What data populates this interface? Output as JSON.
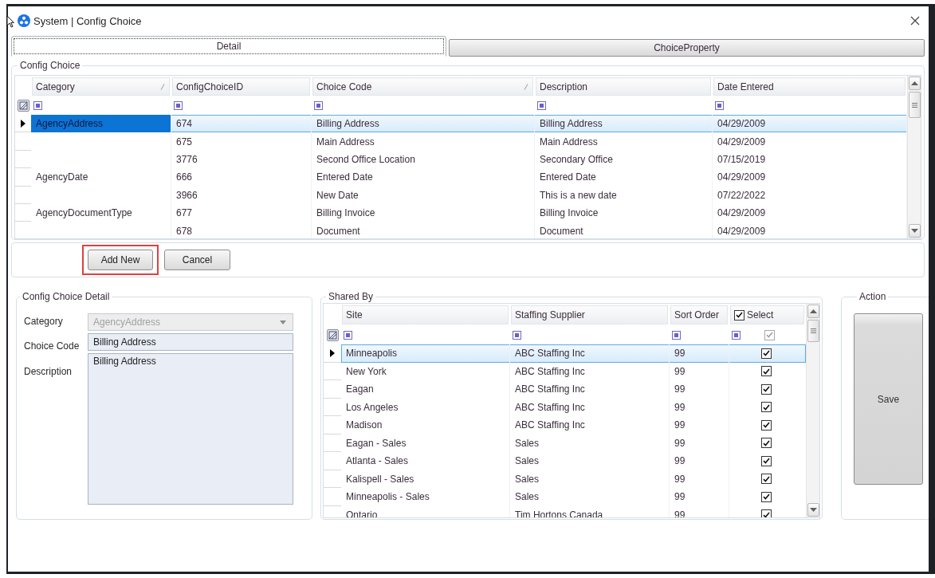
{
  "window": {
    "title": "System | Config Choice"
  },
  "tabs": [
    {
      "label": "Detail",
      "selected": true
    },
    {
      "label": "ChoiceProperty",
      "selected": false
    }
  ],
  "config_choice": {
    "title": "Config Choice",
    "columns": [
      {
        "label": "Category",
        "sorted": true
      },
      {
        "label": "ConfigChoiceID",
        "sorted": false
      },
      {
        "label": "Choice Code",
        "sorted": true
      },
      {
        "label": "Description",
        "sorted": false
      },
      {
        "label": "Date Entered",
        "sorted": false
      }
    ],
    "rows": [
      {
        "category": "AgencyAddress",
        "config_choice_id": "674",
        "choice_code": "Billing Address",
        "description": "Billing Address",
        "date_entered": "04/29/2009",
        "selected": true,
        "focused": true
      },
      {
        "config_choice_id": "675",
        "choice_code": "Main Address",
        "description": "Main Address",
        "date_entered": "04/29/2009",
        "selected": false,
        "focused": false
      },
      {
        "config_choice_id": "3776",
        "choice_code": "Second Office Location",
        "description": "Secondary Office",
        "date_entered": "07/15/2019",
        "selected": false,
        "focused": false
      },
      {
        "category": "AgencyDate",
        "config_choice_id": "666",
        "choice_code": "Entered Date",
        "description": "Entered Date",
        "date_entered": "04/29/2009",
        "selected": false,
        "focused": false
      },
      {
        "config_choice_id": "3966",
        "choice_code": "New Date",
        "description": "This is a new date",
        "date_entered": "07/22/2022",
        "selected": false,
        "focused": false
      },
      {
        "category": "AgencyDocumentType",
        "config_choice_id": "677",
        "choice_code": "Billing Invoice",
        "description": "Billing Invoice",
        "date_entered": "04/29/2009",
        "selected": false,
        "focused": false
      },
      {
        "config_choice_id": "678",
        "choice_code": "Document",
        "description": "Document",
        "date_entered": "04/29/2009",
        "selected": false,
        "focused": false
      }
    ],
    "buttons": [
      {
        "label": "Add New",
        "highlighted": true
      },
      {
        "label": "Cancel",
        "highlighted": false
      }
    ]
  },
  "detail": {
    "title": "Config Choice Detail",
    "category": {
      "label": "Category",
      "value": "AgencyAddress",
      "disabled": true
    },
    "choice_code": {
      "label": "Choice Code",
      "value": "Billing Address"
    },
    "description": {
      "label": "Description",
      "value": "Billing Address"
    }
  },
  "shared_by": {
    "title": "Shared By",
    "columns": [
      {
        "label": "Site",
        "kind": "text"
      },
      {
        "label": "Staffing Supplier",
        "kind": "text"
      },
      {
        "label": "Sort Order",
        "kind": "text"
      },
      {
        "label": "Select",
        "kind": "checkbox",
        "checked": true,
        "filter_checked": true
      }
    ],
    "rows": [
      {
        "cells": [
          "Minneapolis",
          "ABC Staffing Inc",
          "99"
        ],
        "checked": true,
        "selected": true
      },
      {
        "cells": [
          "New York",
          "ABC Staffing Inc",
          "99"
        ],
        "checked": true,
        "selected": false
      },
      {
        "cells": [
          "Eagan",
          "ABC Staffing Inc",
          "99"
        ],
        "checked": true,
        "selected": false
      },
      {
        "cells": [
          "Los Angeles",
          "ABC Staffing Inc",
          "99"
        ],
        "checked": true,
        "selected": false
      },
      {
        "cells": [
          "Madison",
          "ABC Staffing Inc",
          "99"
        ],
        "checked": true,
        "selected": false
      },
      {
        "cells": [
          "Eagan - Sales",
          "Sales",
          "99"
        ],
        "checked": true,
        "selected": false
      },
      {
        "cells": [
          "Atlanta - Sales",
          "Sales",
          "99"
        ],
        "checked": true,
        "selected": false
      },
      {
        "cells": [
          "Kalispell - Sales",
          "Sales",
          "99"
        ],
        "checked": true,
        "selected": false
      },
      {
        "cells": [
          "Minneapolis - Sales",
          "Sales",
          "99"
        ],
        "checked": true,
        "selected": false
      },
      {
        "cells": [
          "Ontario",
          "Tim Hortons Canada",
          "99"
        ],
        "checked": true,
        "selected": false
      }
    ]
  },
  "action": {
    "title": "Action",
    "button": "Save"
  }
}
